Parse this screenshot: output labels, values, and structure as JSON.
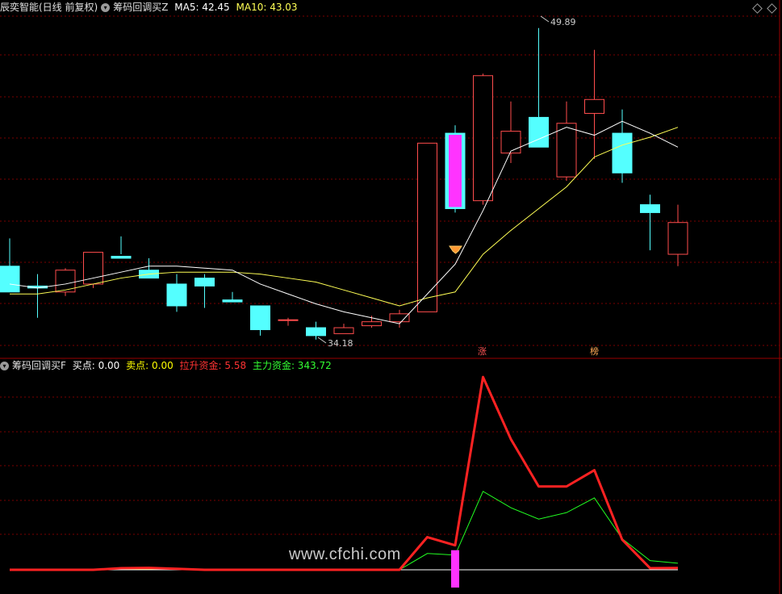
{
  "top_pane": {
    "app_name": "辰奕智能(日线 前复权)",
    "indicator_name": "筹码回调买Z",
    "ma5_label": "MA5: 42.45",
    "ma10_label": "MA10: 43.03",
    "high_label": "49.89",
    "low_label": "34.18",
    "badge_zhang": "涨",
    "badge_bang": "榜",
    "colors": {
      "up": "#ff4d4d",
      "down": "#54ffff",
      "ma5": "#ffffff",
      "ma10": "#ffff55",
      "signal": "#ff33ff",
      "grid": "#7a0000"
    }
  },
  "bottom_pane": {
    "indicator_name": "筹码回调买F",
    "buy_label": "买点: 0.00",
    "sell_label": "卖点: 0.00",
    "rise_fund_label": "拉升资金: 5.58",
    "main_fund_label": "主力资金: 343.72",
    "colors": {
      "buy": "#ffffff",
      "sell": "#ffff00",
      "rise": "#ff2222",
      "main": "#22ff22"
    }
  },
  "watermark": "www.cfchi.com",
  "chart_data": {
    "type": "candlestick",
    "candles": [
      {
        "o": 37.9,
        "h": 39.3,
        "l": 36.7,
        "c": 36.6
      },
      {
        "o": 36.9,
        "h": 37.5,
        "l": 35.3,
        "c": 36.8
      },
      {
        "o": 36.6,
        "h": 37.8,
        "l": 36.4,
        "c": 37.7
      },
      {
        "o": 37.0,
        "h": 38.2,
        "l": 36.8,
        "c": 38.6
      },
      {
        "o": 38.4,
        "h": 39.4,
        "l": 38.5,
        "c": 38.3
      },
      {
        "o": 37.7,
        "h": 38.3,
        "l": 37.4,
        "c": 37.3
      },
      {
        "o": 37.0,
        "h": 37.5,
        "l": 35.6,
        "c": 35.9
      },
      {
        "o": 37.3,
        "h": 37.5,
        "l": 35.8,
        "c": 36.9
      },
      {
        "o": 36.2,
        "h": 36.6,
        "l": 36.1,
        "c": 36.1
      },
      {
        "o": 35.9,
        "h": 35.9,
        "l": 34.4,
        "c": 34.7
      },
      {
        "o": 35.2,
        "h": 35.3,
        "l": 34.9,
        "c": 35.2
      },
      {
        "o": 34.8,
        "h": 35.1,
        "l": 34.2,
        "c": 34.4
      },
      {
        "o": 34.5,
        "h": 35.0,
        "l": 34.5,
        "c": 34.8
      },
      {
        "o": 34.9,
        "h": 35.4,
        "l": 34.8,
        "c": 35.1
      },
      {
        "o": 35.1,
        "h": 35.7,
        "l": 34.8,
        "c": 35.5
      },
      {
        "o": 35.6,
        "h": 44.0,
        "l": 35.6,
        "c": 44.1
      },
      {
        "o": 44.6,
        "h": 45.0,
        "l": 40.6,
        "c": 40.8
      },
      {
        "o": 41.2,
        "h": 47.6,
        "l": 41.0,
        "c": 47.5
      },
      {
        "o": 43.6,
        "h": 46.2,
        "l": 43.1,
        "c": 44.7
      },
      {
        "o": 45.4,
        "h": 49.9,
        "l": 43.9,
        "c": 43.9
      },
      {
        "o": 42.4,
        "h": 46.2,
        "l": 42.2,
        "c": 45.1
      },
      {
        "o": 45.6,
        "h": 48.8,
        "l": 43.3,
        "c": 46.3
      },
      {
        "o": 44.6,
        "h": 45.8,
        "l": 42.1,
        "c": 42.6
      },
      {
        "o": 41.0,
        "h": 41.5,
        "l": 38.7,
        "c": 40.6
      },
      {
        "o": 38.5,
        "h": 41.0,
        "l": 37.9,
        "c": 40.1
      }
    ],
    "signal_candle_index": 16,
    "ma5": [
      37.0,
      36.8,
      37.0,
      37.3,
      37.6,
      37.9,
      37.9,
      37.8,
      37.7,
      37.0,
      36.5,
      36.0,
      35.6,
      35.3,
      35.0,
      36.5,
      38.0,
      40.7,
      43.7,
      44.3,
      44.9,
      44.5,
      45.2,
      44.6,
      43.9
    ],
    "ma10": [
      36.5,
      36.5,
      36.7,
      37.0,
      37.3,
      37.5,
      37.6,
      37.6,
      37.6,
      37.5,
      37.3,
      37.1,
      36.7,
      36.3,
      35.9,
      36.3,
      36.6,
      38.5,
      39.7,
      40.8,
      41.9,
      43.4,
      44.0,
      44.4,
      44.9
    ],
    "rise_fund": [
      0,
      0,
      0,
      0,
      5,
      6,
      3,
      0,
      0,
      0,
      0,
      0,
      0,
      0,
      0,
      100,
      75,
      590,
      400,
      255,
      255,
      305,
      92,
      5,
      5.58
    ],
    "main_fund": [
      0,
      0,
      0,
      0,
      4,
      5,
      2,
      0,
      0,
      0,
      0,
      0,
      0,
      0,
      0,
      50,
      45,
      240,
      190,
      155,
      175,
      220,
      95,
      28,
      20
    ],
    "buy_bar_index": 16,
    "buy_bar_value": 60,
    "price_range": [
      33.5,
      50.5
    ],
    "fund_range": [
      0,
      620
    ]
  }
}
